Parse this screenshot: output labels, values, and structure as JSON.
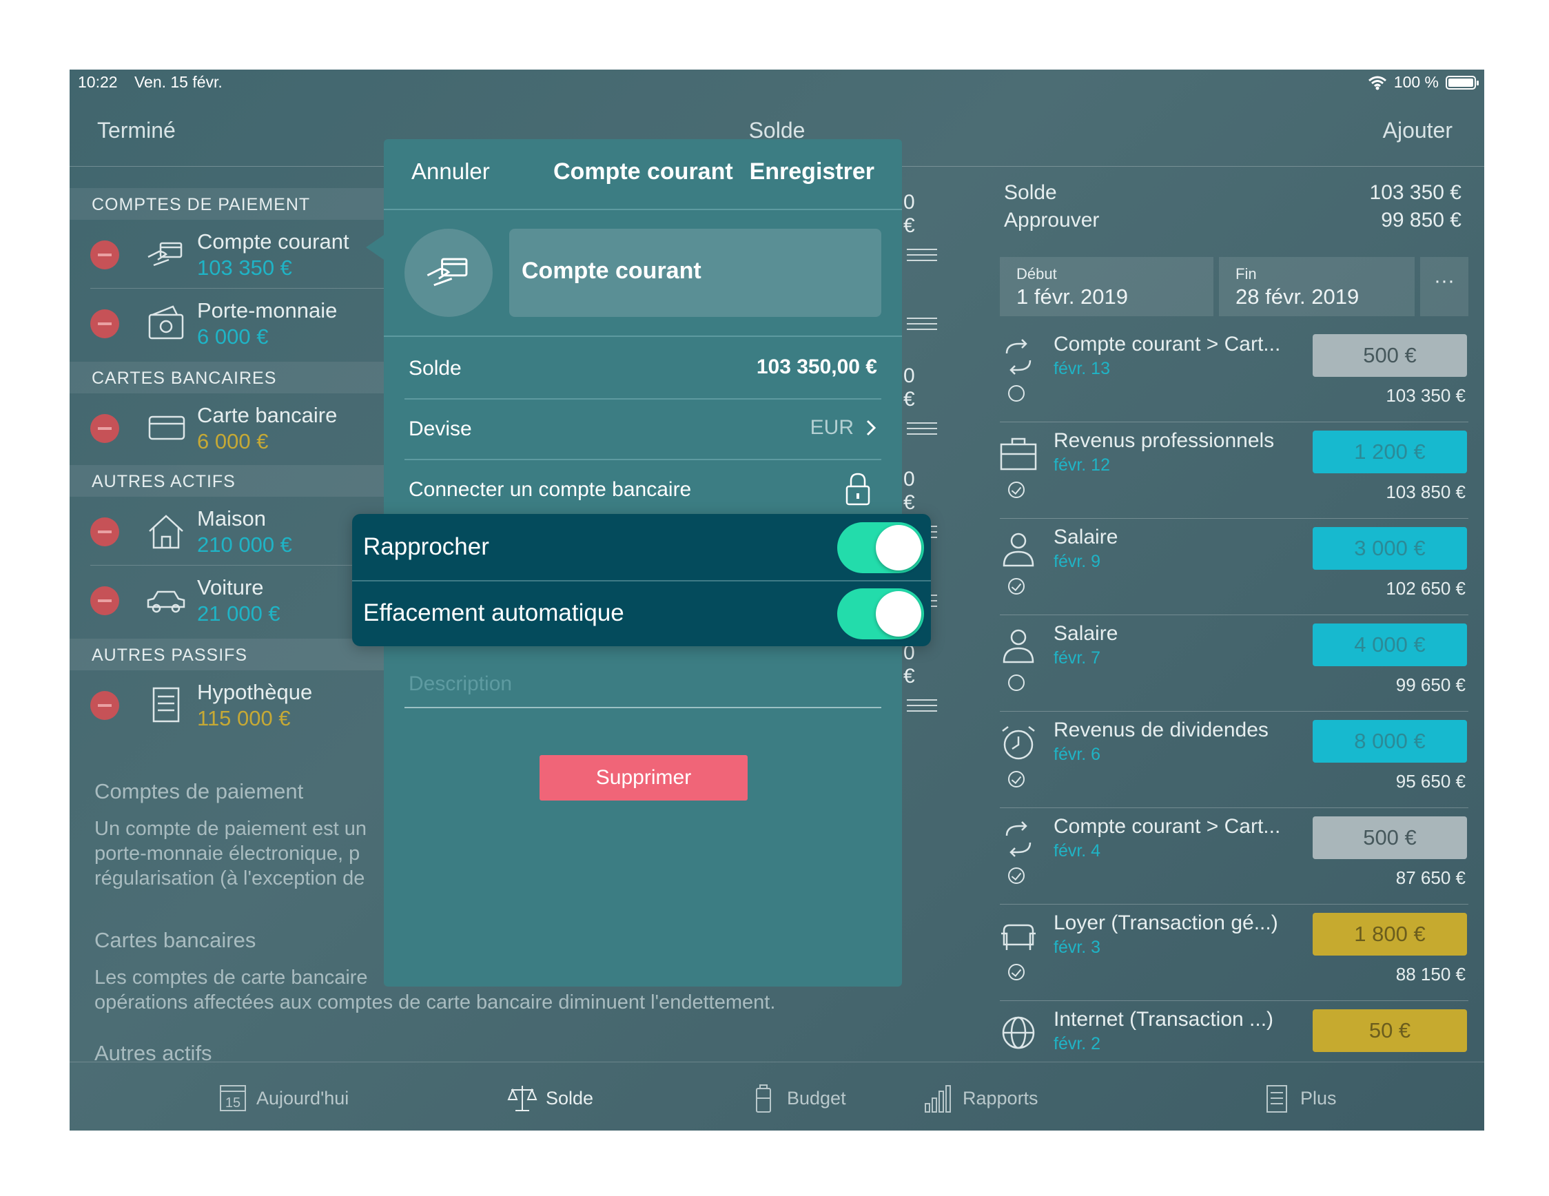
{
  "status_bar": {
    "time": "10:22",
    "date": "Ven. 15 févr.",
    "battery": "100 %"
  },
  "navbar": {
    "done_label": "Terminé",
    "title": "Solde",
    "add_label": "Ajouter"
  },
  "left_list": {
    "sections": [
      {
        "header": "COMPTES DE PAIEMENT",
        "right_amount": "0 €",
        "accounts": [
          {
            "name": "Compte courant",
            "amount": "103 350 €",
            "icon": "card-hand-icon",
            "color": "teal"
          },
          {
            "name": "Porte-monnaie",
            "amount": "6 000 €",
            "icon": "wallet-icon",
            "color": "teal"
          }
        ]
      },
      {
        "header": "CARTES BANCAIRES",
        "right_amount": "0 €",
        "accounts": [
          {
            "name": "Carte bancaire",
            "amount": "6 000 €",
            "icon": "credit-card-icon",
            "color": "gold"
          }
        ]
      },
      {
        "header": "AUTRES ACTIFS",
        "right_amount": "0 €",
        "accounts": [
          {
            "name": "Maison",
            "amount": "210 000 €",
            "icon": "house-icon",
            "color": "teal"
          },
          {
            "name": "Voiture",
            "amount": "21 000 €",
            "icon": "car-icon",
            "color": "teal"
          }
        ]
      },
      {
        "header": "AUTRES PASSIFS",
        "right_amount": "0 €",
        "accounts": [
          {
            "name": "Hypothèque",
            "amount": "115 000 €",
            "icon": "document-icon",
            "color": "gold"
          }
        ]
      }
    ],
    "help": [
      {
        "title": "Comptes de paiement",
        "text": "Un compte de paiement est un\nporte-monnaie électronique, p\nrégularisation (à l'exception de"
      },
      {
        "title": "Cartes bancaires",
        "text": "Les comptes de carte bancaire\nopérations affectées aux comptes de carte bancaire diminuent l'endettement."
      },
      {
        "title": "Autres actifs",
        "text": ""
      }
    ]
  },
  "summary": {
    "solde_label": "Solde",
    "solde_value": "103 350 €",
    "approve_label": "Approuver",
    "approve_value": "99 850 €"
  },
  "date_range": {
    "start_label": "Début",
    "start_value": "1 févr. 2019",
    "end_label": "Fin",
    "end_value": "28 févr. 2019",
    "more": "···"
  },
  "transactions": [
    {
      "name": "Compte courant > Cart...",
      "date": "févr. 13",
      "amount": "500 €",
      "balance": "103 350 €",
      "style": "grey",
      "icon": "transfer-icon",
      "approved": false
    },
    {
      "name": "Revenus professionnels",
      "date": "févr. 12",
      "amount": "1 200 €",
      "balance": "103 850 €",
      "style": "cyan",
      "icon": "briefcase-icon",
      "approved": true
    },
    {
      "name": "Salaire",
      "date": "févr. 9",
      "amount": "3 000 €",
      "balance": "102 650 €",
      "style": "cyan",
      "icon": "person-icon",
      "approved": true
    },
    {
      "name": "Salaire",
      "date": "févr. 7",
      "amount": "4 000 €",
      "balance": "99 650 €",
      "style": "cyan",
      "icon": "person-icon",
      "approved": false
    },
    {
      "name": "Revenus de dividendes",
      "date": "févr. 6",
      "amount": "8 000 €",
      "balance": "95 650 €",
      "style": "cyan",
      "icon": "alarm-clock-icon",
      "approved": true
    },
    {
      "name": "Compte courant > Cart...",
      "date": "févr. 4",
      "amount": "500 €",
      "balance": "87 650 €",
      "style": "grey",
      "icon": "transfer-icon",
      "approved": true
    },
    {
      "name": "Loyer (Transaction gé...)",
      "date": "févr. 3",
      "amount": "1 800 €",
      "balance": "88 150 €",
      "style": "gold",
      "icon": "sofa-icon",
      "approved": true
    },
    {
      "name": "Internet (Transaction ...)",
      "date": "févr. 2",
      "amount": "50 €",
      "balance": "",
      "style": "gold",
      "icon": "globe-icon",
      "approved": false
    }
  ],
  "tabbar": [
    {
      "label": "Aujourd'hui",
      "icon": "calendar-icon",
      "day": "15"
    },
    {
      "label": "Solde",
      "icon": "balance-scale-icon",
      "active": true
    },
    {
      "label": "Budget",
      "icon": "battery-jar-icon"
    },
    {
      "label": "Rapports",
      "icon": "bar-chart-icon"
    },
    {
      "label": "Plus",
      "icon": "list-document-icon"
    }
  ],
  "modal": {
    "cancel_label": "Annuler",
    "title": "Compte courant",
    "save_label": "Enregistrer",
    "account_name": "Compte courant",
    "solde_label": "Solde",
    "solde_value": "103 350,00 €",
    "devise_label": "Devise",
    "devise_value": "EUR",
    "connect_label": "Connecter un compte bancaire",
    "description_placeholder": "Description",
    "delete_label": "Supprimer"
  },
  "toggles": [
    {
      "label": "Rapprocher",
      "on": true
    },
    {
      "label": "Effacement automatique",
      "on": true
    }
  ]
}
